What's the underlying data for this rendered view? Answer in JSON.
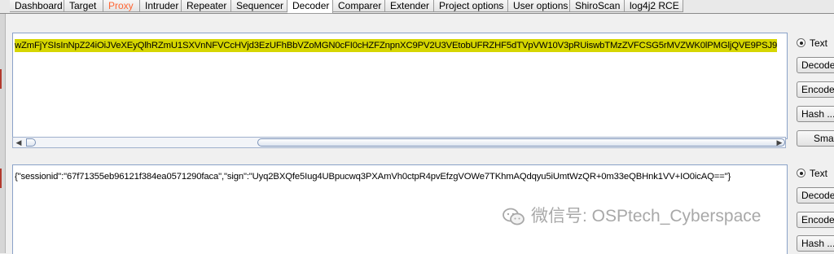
{
  "tabs": [
    {
      "label": "Dashboard"
    },
    {
      "label": "Target"
    },
    {
      "label": "Proxy"
    },
    {
      "label": "Intruder"
    },
    {
      "label": "Repeater"
    },
    {
      "label": "Sequencer"
    },
    {
      "label": "Decoder"
    },
    {
      "label": "Comparer"
    },
    {
      "label": "Extender"
    },
    {
      "label": "Project options"
    },
    {
      "label": "User options"
    },
    {
      "label": "ShiroScan"
    },
    {
      "label": "log4j2 RCE"
    }
  ],
  "active_tab": "Decoder",
  "highlight_tab": "Proxy",
  "top_panel": {
    "content": "wZmFjYSIsInNpZ24iOiJVeXEyQlhRZmU1SXVnNFVCcHVjd3EzUFhBbVZoMGN0cFI0cHZFZnpnXC9PV2U3VEtobUFRZHF5dTVpVW10V3pRUiswbTMzZVFCSG5rMVZWK0lPMGljQVE9PSJ9"
  },
  "bottom_panel": {
    "content": "{\"sessionid\":\"67f71355eb96121f384ea0571290faca\",\"sign\":\"Uyq2BXQfe5Iug4UBpucwq3PXAmVh0ctpR4pvEfzgVOWe7TKhmAQdqyu5iUmtWzQR+0m33eQBHnk1VV+IO0icAQ==\"}"
  },
  "top_controls": {
    "radio_label": "Text",
    "decode_label": "Decode ...",
    "encode_label": "Encode ...",
    "hash_label": "Hash ...",
    "smart_label": "Smart decode"
  },
  "bottom_controls": {
    "radio_label": "Text",
    "decode_label": "Decode ...",
    "encode_label": "Encode ...",
    "hash_label": "Hash ..."
  },
  "watermark": {
    "text": "微信号: OSPtech_Cyberspace"
  }
}
